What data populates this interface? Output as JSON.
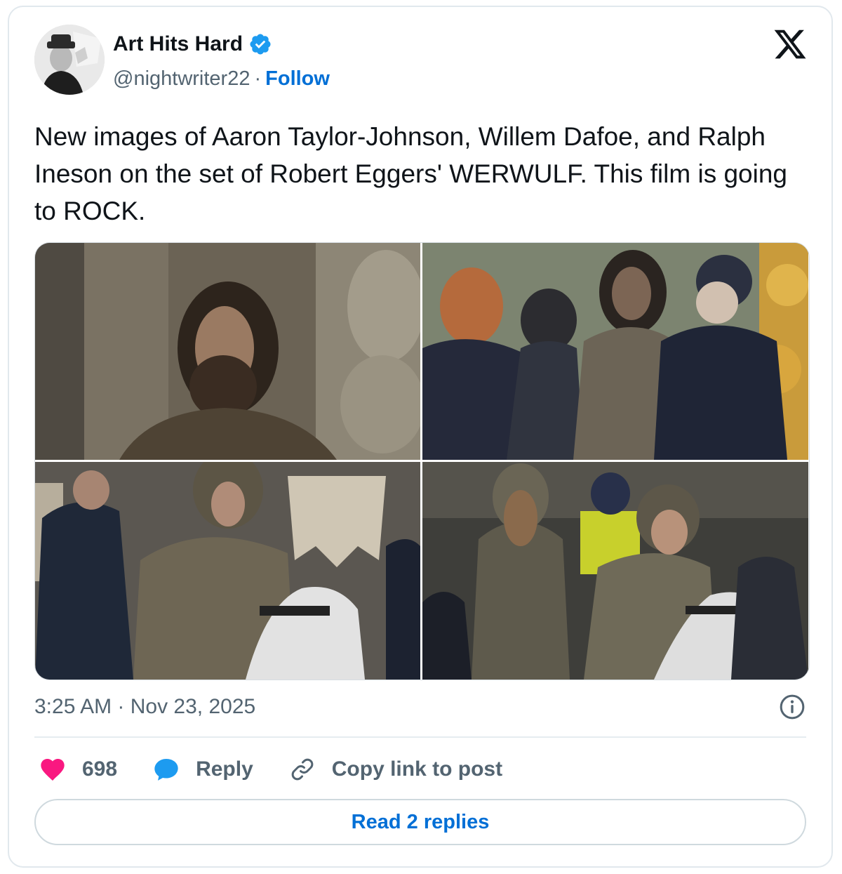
{
  "author": {
    "name": "Art Hits Hard",
    "handle": "@nightwriter22",
    "separator": "·",
    "follow_label": "Follow"
  },
  "tweet": {
    "text": "New images of Aaron Taylor-Johnson, Willem Dafoe, and Ralph Ineson on the set of Robert Eggers' WERWULF. This film is going to ROCK.",
    "timestamp": "3:25 AM · Nov 23, 2025"
  },
  "actions": {
    "like_count": "698",
    "reply_label": "Reply",
    "copy_label": "Copy link to post"
  },
  "read_replies_label": "Read 2 replies",
  "icons": {
    "brand": "x-logo-icon",
    "verified": "verified-badge-icon",
    "info": "info-icon",
    "like": "heart-icon",
    "reply": "speech-bubble-icon",
    "copy": "link-icon"
  },
  "colors": {
    "accent": "#006fd6",
    "like": "#f91880",
    "reply": "#1d9bf0",
    "muted": "#536471",
    "text": "#0f1419"
  }
}
